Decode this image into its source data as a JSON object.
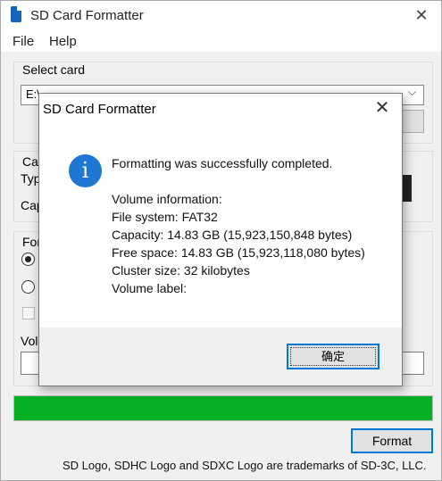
{
  "app": {
    "title": "SD Card Formatter",
    "close_glyph": "✕"
  },
  "menu": {
    "file": "File",
    "help": "Help"
  },
  "select_card": {
    "label": "Select card",
    "value": "E:\\"
  },
  "card_info": {
    "label_fragment": "Car",
    "type_fragment": "Typ",
    "capacity_fragment": "Cap"
  },
  "format_options": {
    "label_fragment": "For",
    "volume_label_fragment": "Volu"
  },
  "progress": {
    "fraction": 1.0,
    "color": "#06b025"
  },
  "format_button": "Format",
  "trademark": "SD Logo, SDHC Logo and SDXC Logo are trademarks of SD-3C, LLC.",
  "dialog": {
    "title": "SD Card Formatter",
    "close_glyph": "✕",
    "icon": "info-icon",
    "icon_glyph": "i",
    "message": "Formatting was successfully completed.",
    "volume_info_heading": "Volume information:",
    "file_system": "File system: FAT32",
    "capacity": "Capacity: 14.83 GB (15,923,150,848 bytes)",
    "free_space": "Free space: 14.83 GB (15,923,118,080 bytes)",
    "cluster_size": "Cluster size: 32 kilobytes",
    "volume_label": "Volume label:",
    "ok_button": "确定"
  }
}
